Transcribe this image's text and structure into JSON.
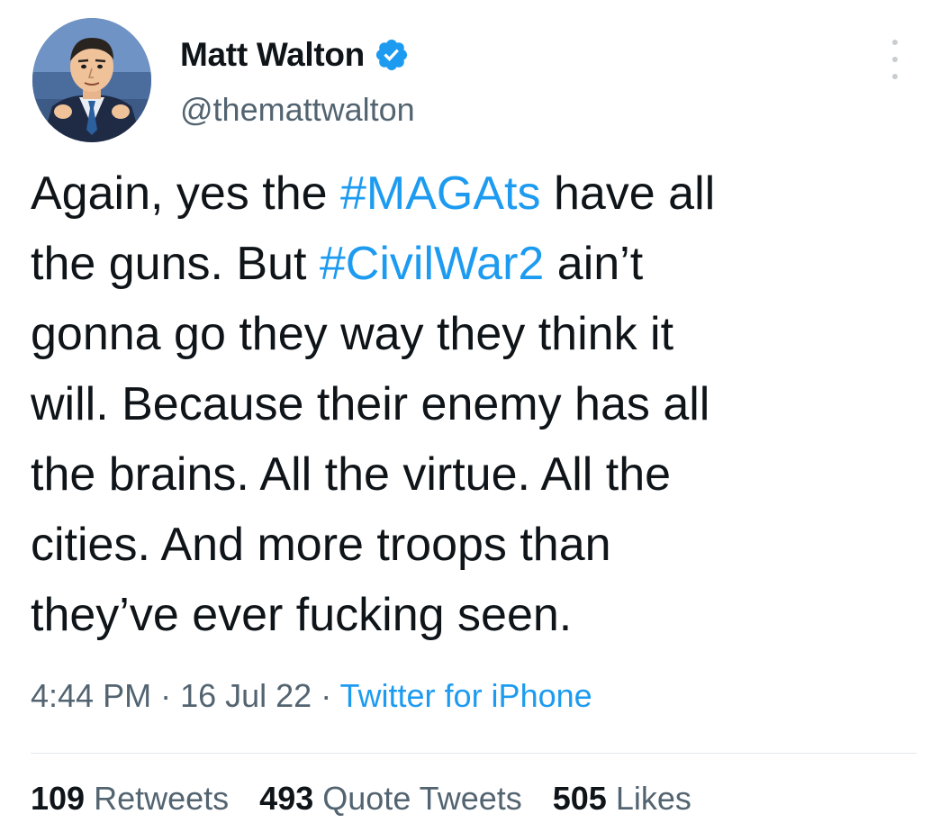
{
  "author": {
    "display_name": "Matt Walton",
    "handle": "@themattwalton",
    "verified": true,
    "avatar_icon": "cartoon-portrait-avatar"
  },
  "tweet": {
    "lines": [
      [
        {
          "t": "Again, yes the "
        },
        {
          "t": "#MAGAts",
          "tag": true
        },
        {
          "t": " have all"
        }
      ],
      [
        {
          "t": "the guns. But "
        },
        {
          "t": "#CivilWar2",
          "tag": true
        },
        {
          "t": " ain’t"
        }
      ],
      [
        {
          "t": "gonna go they way they think it"
        }
      ],
      [
        {
          "t": "will. Because their enemy has all"
        }
      ],
      [
        {
          "t": "the brains. All the virtue. All the"
        }
      ],
      [
        {
          "t": "cities. And more troops than"
        }
      ],
      [
        {
          "t": "they’ve ever fucking seen."
        }
      ]
    ]
  },
  "meta": {
    "time": "4:44 PM",
    "separator": " · ",
    "date": "16 Jul 22",
    "source": "Twitter for iPhone"
  },
  "stats": {
    "retweets_count": "109",
    "retweets_label": "Retweets",
    "quotes_count": "493",
    "quotes_label": "Quote Tweets",
    "likes_count": "505",
    "likes_label": "Likes"
  },
  "colors": {
    "link": "#1d9bf0",
    "secondary_text": "#536471",
    "primary_text": "#0f1419"
  },
  "icons": {
    "verified": "verified-badge-icon",
    "more": "more-options-icon"
  }
}
